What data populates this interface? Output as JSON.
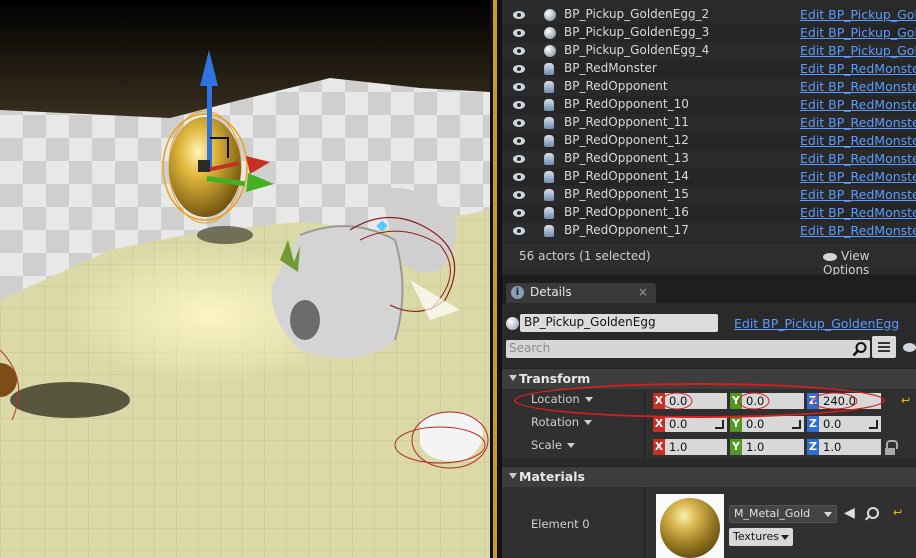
{
  "outliner": {
    "rows": [
      {
        "name": "BP_Pickup_GoldenEgg_2",
        "edit": "Edit BP_Pickup_Gol",
        "icon": "sphere-icon"
      },
      {
        "name": "BP_Pickup_GoldenEgg_3",
        "edit": "Edit BP_Pickup_Gol",
        "icon": "sphere-icon"
      },
      {
        "name": "BP_Pickup_GoldenEgg_4",
        "edit": "Edit BP_Pickup_Gol",
        "icon": "sphere-icon"
      },
      {
        "name": "BP_RedMonster",
        "edit": "Edit BP_RedMonste",
        "icon": "pawn-icon"
      },
      {
        "name": "BP_RedOpponent",
        "edit": "Edit BP_RedMonste",
        "icon": "pawn-icon"
      },
      {
        "name": "BP_RedOpponent_10",
        "edit": "Edit BP_RedMonste",
        "icon": "pawn-icon"
      },
      {
        "name": "BP_RedOpponent_11",
        "edit": "Edit BP_RedMonste",
        "icon": "pawn-icon"
      },
      {
        "name": "BP_RedOpponent_12",
        "edit": "Edit BP_RedMonste",
        "icon": "pawn-icon"
      },
      {
        "name": "BP_RedOpponent_13",
        "edit": "Edit BP_RedMonste",
        "icon": "pawn-icon"
      },
      {
        "name": "BP_RedOpponent_14",
        "edit": "Edit BP_RedMonste",
        "icon": "pawn-icon"
      },
      {
        "name": "BP_RedOpponent_15",
        "edit": "Edit BP_RedMonste",
        "icon": "pawn-icon"
      },
      {
        "name": "BP_RedOpponent_16",
        "edit": "Edit BP_RedMonste",
        "icon": "pawn-icon"
      },
      {
        "name": "BP_RedOpponent_17",
        "edit": "Edit BP_RedMonste",
        "icon": "pawn-icon"
      }
    ],
    "actor_count": "56 actors (1 selected)",
    "view_options": "View Options"
  },
  "details": {
    "tab_label": "Details",
    "tab_close": "×",
    "actor_name": "BP_Pickup_GoldenEgg",
    "edit_blueprint": "Edit BP_Pickup_GoldenEgg",
    "search_placeholder": "Search",
    "transform": {
      "title": "Transform",
      "axis_labels": {
        "x": "X",
        "y": "Y",
        "z": "Z"
      },
      "location": {
        "label": "Location",
        "x": "0.0",
        "y": "0.0",
        "z": "240.0"
      },
      "rotation": {
        "label": "Rotation",
        "x": "0.0",
        "y": "0.0",
        "z": "0.0"
      },
      "scale": {
        "label": "Scale",
        "x": "1.0",
        "y": "1.0",
        "z": "1.0"
      }
    },
    "materials": {
      "title": "Materials",
      "element_label": "Element 0",
      "material_name": "M_Metal_Gold",
      "textures_label": "Textures"
    }
  },
  "colors": {
    "selection_outline": "#c79a2a",
    "link_blue": "#5b9bff",
    "annotation_red": "#d42020",
    "axis_x": "#c62f21",
    "axis_y": "#4f9b21",
    "axis_z": "#2f6fcf"
  }
}
